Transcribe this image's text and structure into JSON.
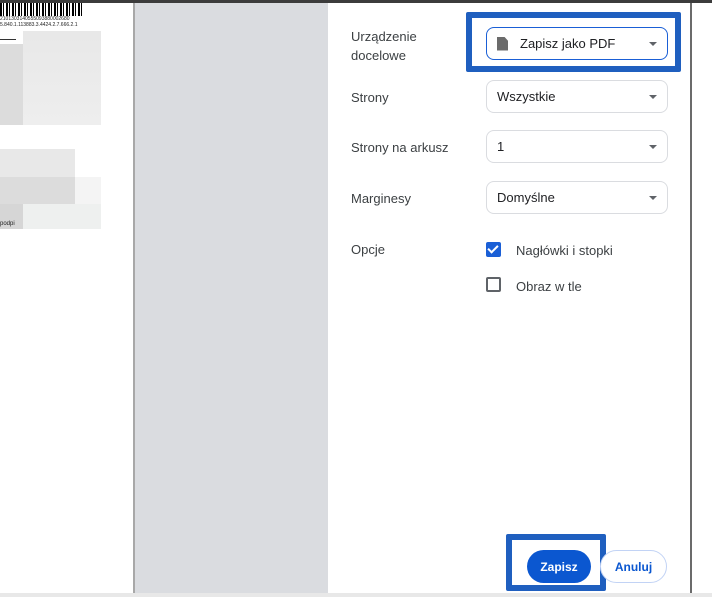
{
  "preview": {
    "barcode_line1": "2101303140555093880002680",
    "barcode_line2": "5.840.1.113883.3.4424.2.7.666.2.1",
    "footer_fragment": "podpi"
  },
  "settings": {
    "destination": {
      "label": "Urządzenie docelowe",
      "value": "Zapisz jako PDF",
      "icon": "document-icon"
    },
    "pages": {
      "label": "Strony",
      "value": "Wszystkie"
    },
    "pages_per_sheet": {
      "label": "Strony na arkusz",
      "value": "1"
    },
    "margins": {
      "label": "Marginesy",
      "value": "Domyślne"
    },
    "options": {
      "label": "Opcje",
      "items": [
        {
          "label": "Nagłówki i stopki",
          "checked": true
        },
        {
          "label": "Obraz w tle",
          "checked": false
        }
      ]
    }
  },
  "actions": {
    "save": "Zapisz",
    "cancel": "Anuluj"
  },
  "colors": {
    "accent": "#0b57d0",
    "highlight": "#1f5fbf"
  }
}
